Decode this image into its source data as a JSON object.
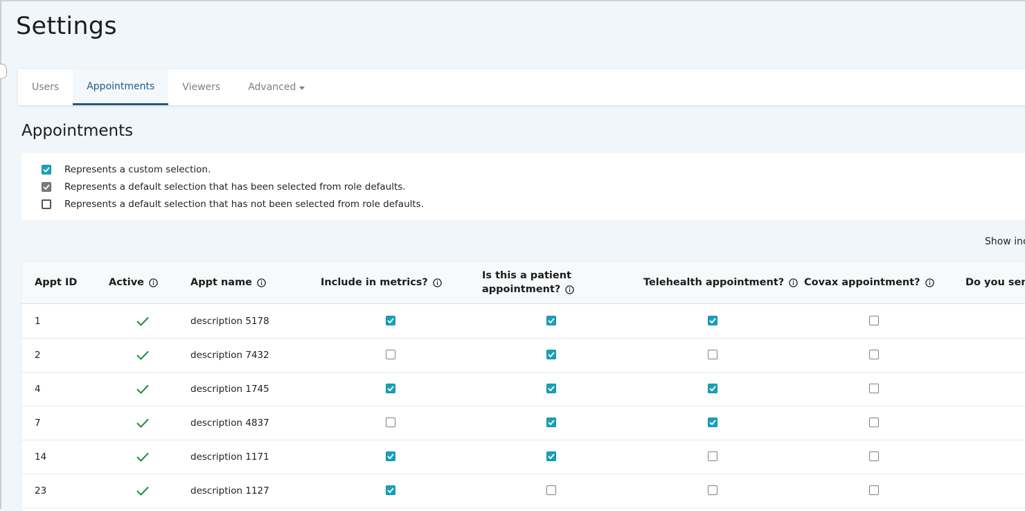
{
  "page": {
    "title": "Settings"
  },
  "tabs": [
    {
      "label": "Users",
      "active": false
    },
    {
      "label": "Appointments",
      "active": true
    },
    {
      "label": "Viewers",
      "active": false
    },
    {
      "label": "Advanced",
      "active": false,
      "dropdown": true
    }
  ],
  "section": {
    "title": "Appointments"
  },
  "legend": [
    {
      "type": "custom",
      "text": "Represents a custom selection."
    },
    {
      "type": "default",
      "text": "Represents a default selection that has been selected from role defaults."
    },
    {
      "type": "empty",
      "text": "Represents a default selection that has not been selected from role defaults."
    }
  ],
  "toolbar": {
    "show_inactive_label": "Show inc"
  },
  "table": {
    "headers": {
      "id": "Appt ID",
      "active": "Active",
      "name": "Appt name",
      "metrics": "Include in metrics?",
      "patient_line1": "Is this a patient",
      "patient_line2": "appointment?",
      "telehealth": "Telehealth appointment?",
      "covax": "Covax appointment?",
      "send": "Do you sen"
    },
    "rows": [
      {
        "id": "1",
        "active": true,
        "name": "description 5178",
        "metrics": true,
        "patient": true,
        "telehealth": true,
        "covax": false
      },
      {
        "id": "2",
        "active": true,
        "name": "description 7432",
        "metrics": false,
        "patient": true,
        "telehealth": false,
        "covax": false
      },
      {
        "id": "4",
        "active": true,
        "name": "description 1745",
        "metrics": true,
        "patient": true,
        "telehealth": true,
        "covax": false
      },
      {
        "id": "7",
        "active": true,
        "name": "description 4837",
        "metrics": false,
        "patient": true,
        "telehealth": true,
        "covax": false
      },
      {
        "id": "14",
        "active": true,
        "name": "description 1171",
        "metrics": true,
        "patient": true,
        "telehealth": false,
        "covax": false
      },
      {
        "id": "23",
        "active": true,
        "name": "description 1127",
        "metrics": true,
        "patient": false,
        "telehealth": false,
        "covax": false
      }
    ]
  },
  "colors": {
    "accent": "#18a2b8",
    "active_tab": "#1c5a8a",
    "check_green": "#1e8a3c"
  }
}
